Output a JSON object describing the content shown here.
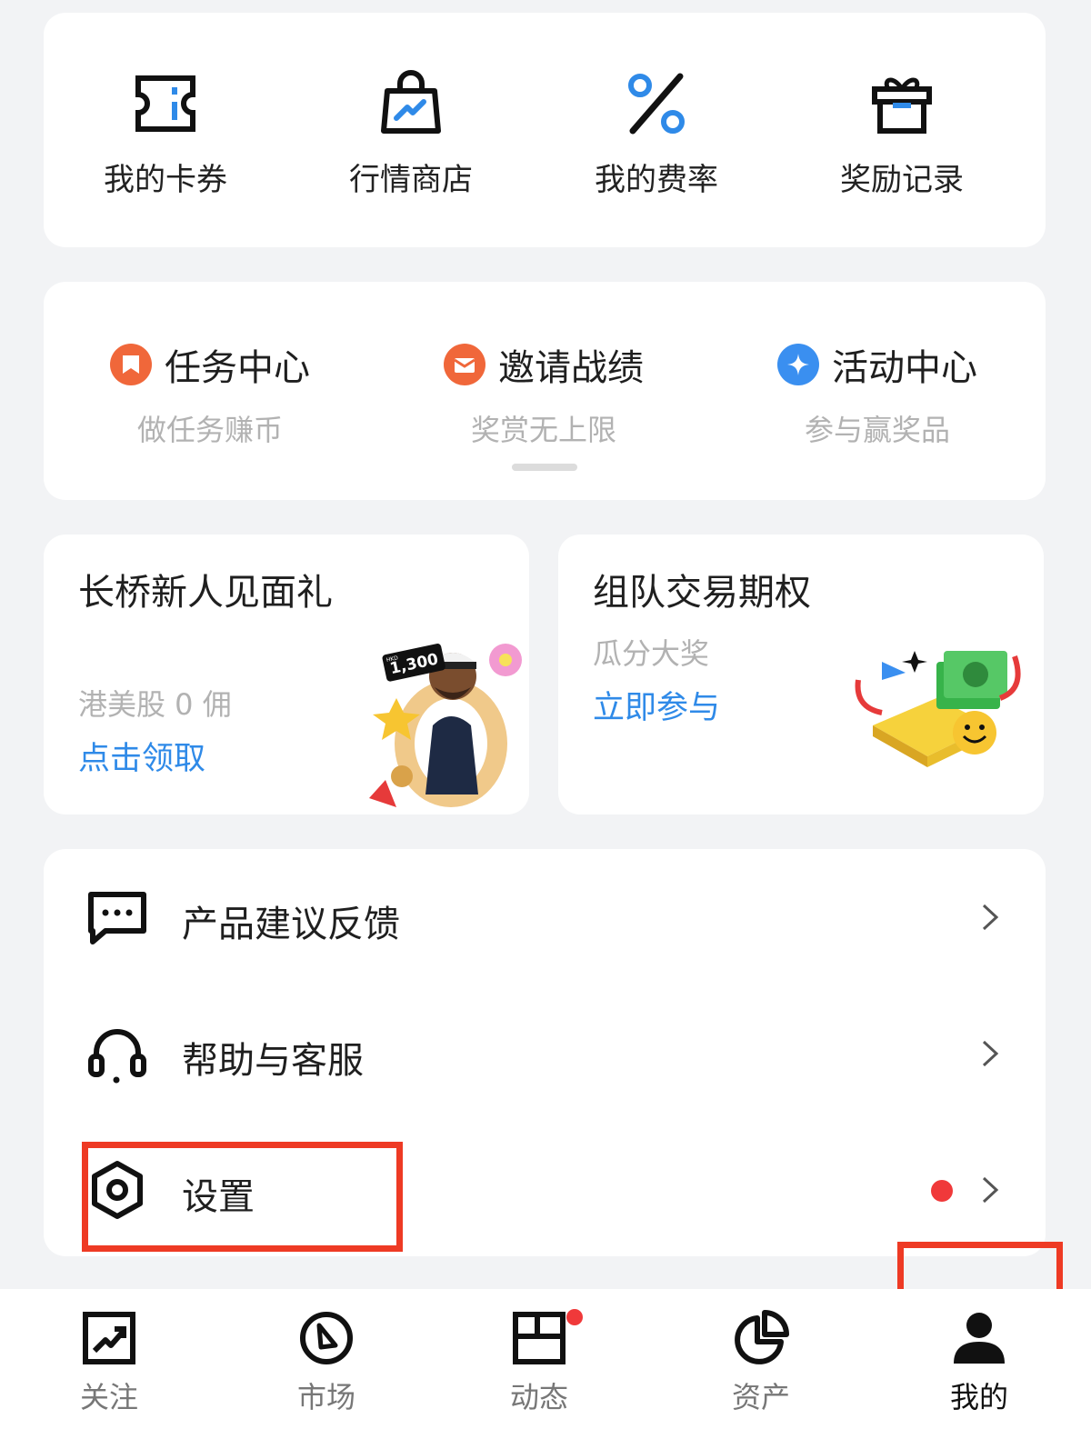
{
  "quick_entries": [
    {
      "label": "我的卡券",
      "icon": "ticket-icon"
    },
    {
      "label": "行情商店",
      "icon": "shopping-bag-icon"
    },
    {
      "label": "我的费率",
      "icon": "percent-icon"
    },
    {
      "label": "奖励记录",
      "icon": "gift-icon"
    }
  ],
  "tasks": [
    {
      "title": "任务中心",
      "subtitle": "做任务赚币",
      "icon": "bookmark-icon",
      "icon_color": "#f0673a"
    },
    {
      "title": "邀请战绩",
      "subtitle": "奖赏无上限",
      "icon": "envelope-icon",
      "icon_color": "#f0673a"
    },
    {
      "title": "活动中心",
      "subtitle": "参与赢奖品",
      "icon": "sparkle-icon",
      "icon_color": "#3a8ff0"
    }
  ],
  "promos": {
    "left": {
      "title": "长桥新人见面礼",
      "subtitle": "港美股 0 佣",
      "link": "点击领取",
      "badge_text": "1,300",
      "badge_currency": "HKD"
    },
    "right": {
      "title": "组队交易期权",
      "subtitle": "瓜分大奖",
      "link": "立即参与"
    }
  },
  "menu": [
    {
      "label": "产品建议反馈",
      "icon": "feedback-icon"
    },
    {
      "label": "帮助与客服",
      "icon": "headset-icon"
    },
    {
      "label": "设置",
      "icon": "settings-icon",
      "has_dot": true
    }
  ],
  "tabbar": [
    {
      "label": "关注",
      "icon": "trend-icon"
    },
    {
      "label": "市场",
      "icon": "compass-icon"
    },
    {
      "label": "动态",
      "icon": "feed-icon",
      "has_dot": true
    },
    {
      "label": "资产",
      "icon": "pie-chart-icon"
    },
    {
      "label": "我的",
      "icon": "person-icon",
      "active": true
    }
  ],
  "colors": {
    "accent_blue": "#2f8ae8",
    "highlight_red": "#ee3a24",
    "dot_red": "#f0393a",
    "task_orange": "#f0673a"
  }
}
